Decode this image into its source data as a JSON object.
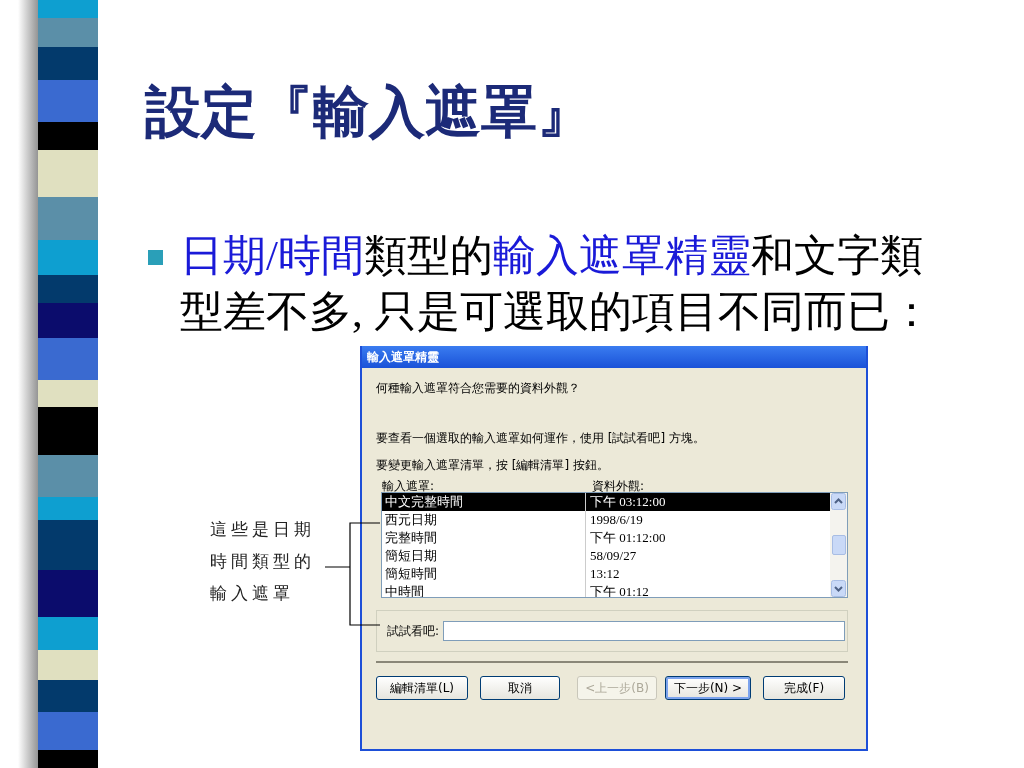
{
  "slide": {
    "title": "設定『輸入遮罩』",
    "bullet": {
      "lines": [
        [
          {
            "text": "日期/時間",
            "highlight": true
          },
          {
            "text": "類型的",
            "highlight": false
          },
          {
            "text": "輸入遮罩精靈",
            "highlight": true
          },
          {
            "text": "和文字類",
            "highlight": false
          }
        ],
        [
          {
            "text": "型差不多, 只是可選取的項目不同而已：",
            "highlight": false
          }
        ]
      ]
    },
    "annotation": {
      "lines": [
        "這些是日期",
        "時間類型的",
        "輸入遮罩"
      ]
    }
  },
  "dialog": {
    "title": "輸入遮罩精靈",
    "question": "何種輸入遮罩符合您需要的資料外觀？",
    "instructions": [
      "要查看一個選取的輸入遮罩如何運作，使用 [試試看吧] 方塊。",
      "要變更輸入遮罩清單，按 [編輯清單] 按鈕。"
    ],
    "columns": [
      "輸入遮罩:",
      "資料外觀:"
    ],
    "rows": [
      {
        "mask": "中文完整時間",
        "appearance": "下午 03:12:00",
        "selected": true
      },
      {
        "mask": "西元日期",
        "appearance": "1998/6/19",
        "selected": false
      },
      {
        "mask": "完整時間",
        "appearance": "下午 01:12:00",
        "selected": false
      },
      {
        "mask": "簡短日期",
        "appearance": "58/09/27",
        "selected": false
      },
      {
        "mask": "簡短時間",
        "appearance": "13:12",
        "selected": false
      },
      {
        "mask": "中時間",
        "appearance": "下午 01:12",
        "selected": false
      }
    ],
    "try_it": {
      "label": "試試看吧:"
    },
    "buttons": [
      {
        "label": "編輯清單(L)",
        "disabled": false,
        "default": false
      },
      {
        "label": "取消",
        "disabled": false,
        "default": false
      },
      {
        "label": "<上一步(B)",
        "disabled": true,
        "default": false
      },
      {
        "label": "下一步(N) >",
        "disabled": false,
        "default": true
      },
      {
        "label": "完成(F)",
        "disabled": false,
        "default": false
      }
    ]
  }
}
